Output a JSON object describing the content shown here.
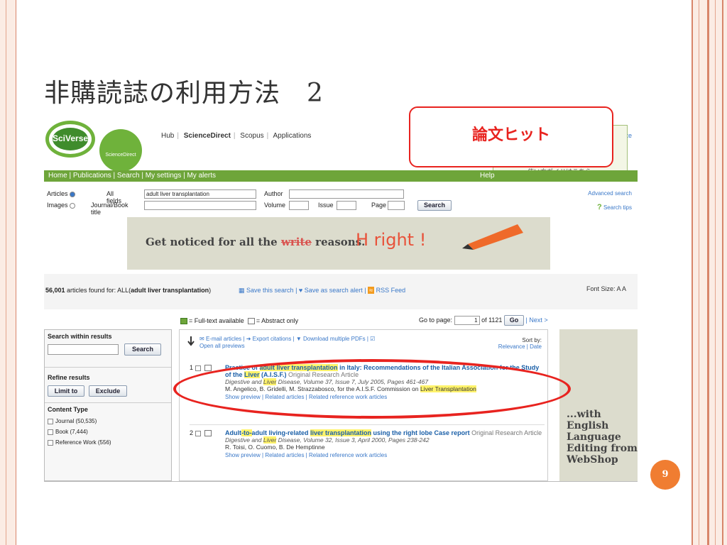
{
  "slide": {
    "title": "非購読誌の利用方法　2",
    "page_number": "9"
  },
  "callout": {
    "text": "論文ヒット"
  },
  "top": {
    "logo": "SciVerse",
    "logo_sub": "ScienceDirect",
    "nav": [
      "Hub",
      "ScienceDirect",
      "Scopus",
      "Applications"
    ],
    "suite": "Suite",
    "popup": "使い方ガイドはこちら"
  },
  "greenbar": {
    "items": "Home | Publications | Search | My settings | My alerts",
    "help": "Help"
  },
  "search": {
    "articles": "Articles",
    "images": "Images",
    "all_fields_label": "All fields",
    "all_fields_value": "adult liver transplantation",
    "journal_label": "Journal/Book title",
    "author_label": "Author",
    "volume_label": "Volume",
    "issue_label": "Issue",
    "page_label": "Page",
    "search_button": "Search",
    "advanced": "Advanced search",
    "tips": "Search tips"
  },
  "banner": {
    "text_prefix": "Get noticed for all the ",
    "strike": "write",
    "text_suffix": " reasons.",
    "handwriting": "H right !"
  },
  "count": {
    "number": "56,001",
    "text": " articles found for: ALL(",
    "query": "adult liver transplantation",
    "close": ")",
    "save_search": "Save this search",
    "save_alert": "Save as search alert",
    "rss": "RSS Feed",
    "font_size": "Font Size: A A"
  },
  "legend": {
    "full": "= Full-text available",
    "abstract": "= Abstract only"
  },
  "pager": {
    "go_label": "Go to page:",
    "page": "1",
    "of": "of 1121",
    "go": "Go",
    "next": "| Next >"
  },
  "sidebar": {
    "search_within": "Search within results",
    "search_btn": "Search",
    "refine": "Refine results",
    "limit": "Limit to",
    "exclude": "Exclude",
    "content_type": "Content Type",
    "types": [
      "Journal (50,535)",
      "Book (7,444)",
      "Reference Work (556)"
    ]
  },
  "tools": {
    "email": "E-mail articles",
    "export": "Export citations",
    "download": "Download multiple PDFs",
    "open_all": "Open all previews",
    "sort_label": "Sort by:",
    "sort_opts": "Relevance | Date"
  },
  "results": [
    {
      "num": "1",
      "title_a": "Practice of ",
      "title_hl": "adult liver transplantation",
      "title_b": " in Italy: Recommendations of the Italian Association for the Study of the ",
      "title_hl2": "Liver",
      "title_c": " (A.I.S.F.)",
      "type": "Original Research Article",
      "source_a": "Digestive and ",
      "source_hl": "Liver",
      "source_b": " Disease, Volume 37, Issue 7, July 2005, Pages 461-467",
      "authors_a": "M. Angelico, B. Gridelli, M. Strazzabosco, for the A.I.S.F. Commission on ",
      "authors_hl": "Liver Transplantation",
      "links": "Show preview | Related articles | Related reference work articles"
    },
    {
      "num": "2",
      "title_a": "Adult",
      "title_hl": "-to-",
      "title_b": "adult living-related ",
      "title_hl2": "liver transplantation",
      "title_c": " using the right lobe Case report",
      "type": "Original Research Article",
      "source_a": "Digestive and ",
      "source_hl": "Liver",
      "source_b": " Disease, Volume 32, Issue 3, April 2000, Pages 238-242",
      "authors_a": "R. Toisi, O. Cuomo, B. De Hemptinne",
      "authors_hl": "",
      "links": "Show preview | Related articles | Related reference work articles"
    }
  ],
  "ad": {
    "text": "...with English Language Editing from WebShop"
  }
}
